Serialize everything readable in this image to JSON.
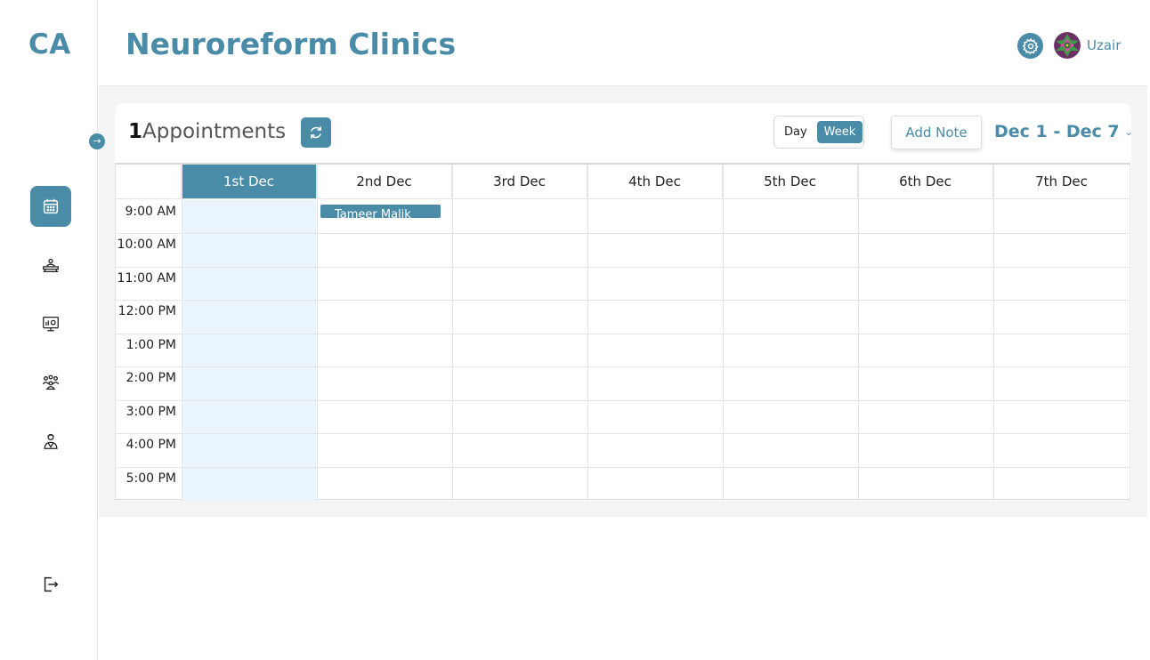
{
  "app": {
    "logo": "CA",
    "title": "Neuroreform Clinics",
    "user": {
      "name": "Uzair"
    }
  },
  "sidebar": {
    "items": [
      {
        "icon": "calendar-icon",
        "active": true
      },
      {
        "icon": "patient-bed-icon",
        "active": false
      },
      {
        "icon": "monitor-chart-icon",
        "active": false
      },
      {
        "icon": "users-group-icon",
        "active": false
      },
      {
        "icon": "doctor-icon",
        "active": false
      }
    ],
    "logout_icon": "logout-icon",
    "toggle_icon": "arrow-right-icon"
  },
  "toolbar": {
    "appointment_count": "1",
    "appointment_label": "Appointments",
    "view_options": [
      "Day",
      "Week"
    ],
    "selected_view": "Week",
    "add_note_label": "Add Note",
    "date_range": "Dec 1 - Dec 7"
  },
  "calendar": {
    "days": [
      "1st Dec",
      "2nd Dec",
      "3rd Dec",
      "4th Dec",
      "5th Dec",
      "6th Dec",
      "7th Dec"
    ],
    "today": "1st Dec",
    "times": [
      "9:00 AM",
      "10:00 AM",
      "11:00 AM",
      "12:00 PM",
      "1:00 PM",
      "2:00 PM",
      "3:00 PM",
      "4:00 PM",
      "5:00 PM"
    ],
    "events": [
      {
        "title": "Tameer Malik",
        "day": "2nd Dec",
        "time": "9:00 AM"
      }
    ]
  },
  "colors": {
    "accent": "#4a8ca8",
    "today_column": "#eaf4fd"
  }
}
